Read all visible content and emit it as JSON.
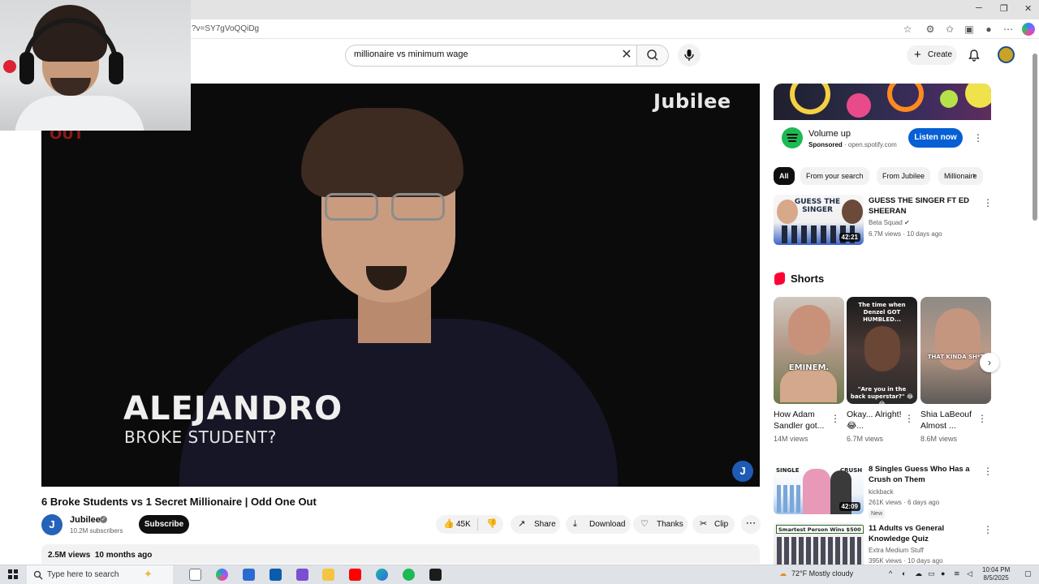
{
  "browser": {
    "url_fragment": "?v=SY7gVoQQiDg",
    "window_controls": [
      "─",
      "❐",
      "✕"
    ]
  },
  "header": {
    "search_value": "millionaire vs minimum wage",
    "create_label": "Create"
  },
  "player": {
    "logo_text": "Jubilee",
    "corner_fragment": "OUT",
    "name_caption": "ALEJANDRO",
    "role_caption": "BROKE STUDENT?",
    "badge": "J"
  },
  "video": {
    "title": "6 Broke Students vs 1 Secret Millionaire | Odd One Out",
    "channel": "Jubilee",
    "subscribers": "10.2M subscribers",
    "subscribe_label": "Subscribe",
    "likes": "45K",
    "share_label": "Share",
    "download_label": "Download",
    "thanks_label": "Thanks",
    "clip_label": "Clip",
    "views": "2.5M views",
    "age": "10 months ago"
  },
  "ad": {
    "title": "Volume up",
    "sponsored": "Sponsored",
    "domain": "open.spotify.com",
    "cta": "Listen now"
  },
  "chips": [
    "All",
    "From your search",
    "From Jubilee",
    "Millionaire"
  ],
  "recommendations": [
    {
      "thumb_text": "GUESS THE SINGER",
      "title": "GUESS THE SINGER FT ED SHEERAN",
      "channel": "Beta Squad",
      "meta": "6.7M views · 10 days ago",
      "duration": "42:21"
    },
    {
      "thumb_left": "SINGLE",
      "thumb_right": "CRUSH",
      "title": "8 Singles Guess Who Has a Crush on Them",
      "channel": "kickback",
      "meta": "261K views · 6 days ago",
      "badge": "New",
      "duration": "42:09"
    },
    {
      "thumb_text": "Smartest Person Wins $500",
      "title": "11 Adults vs General Knowledge Quiz",
      "channel": "Extra Medium Stuff",
      "meta": "395K views · 10 days ago"
    }
  ],
  "shorts": {
    "heading": "Shorts",
    "items": [
      {
        "caption": "EMINEM.",
        "title": "How Adam Sandler got...",
        "views": "14M views"
      },
      {
        "caption_top": "The time when Denzel GOT HUMBLED...",
        "caption_bottom": "\"Are you in the back superstar?\" 😂😂",
        "title": "Okay... Alright! 😂...",
        "views": "6.7M views"
      },
      {
        "caption": "THAT KINDA SH*T",
        "title": "Shia LaBeouf Almost ...",
        "views": "8.6M views"
      }
    ]
  },
  "taskbar": {
    "search_placeholder": "Type here to search",
    "weather": "72°F  Mostly cloudy",
    "time": "10:04 PM",
    "date": "8/5/2025"
  },
  "colors": {
    "accent_blue": "#065fd4",
    "youtube_red": "#ff0033",
    "spotify_green": "#1db954"
  }
}
